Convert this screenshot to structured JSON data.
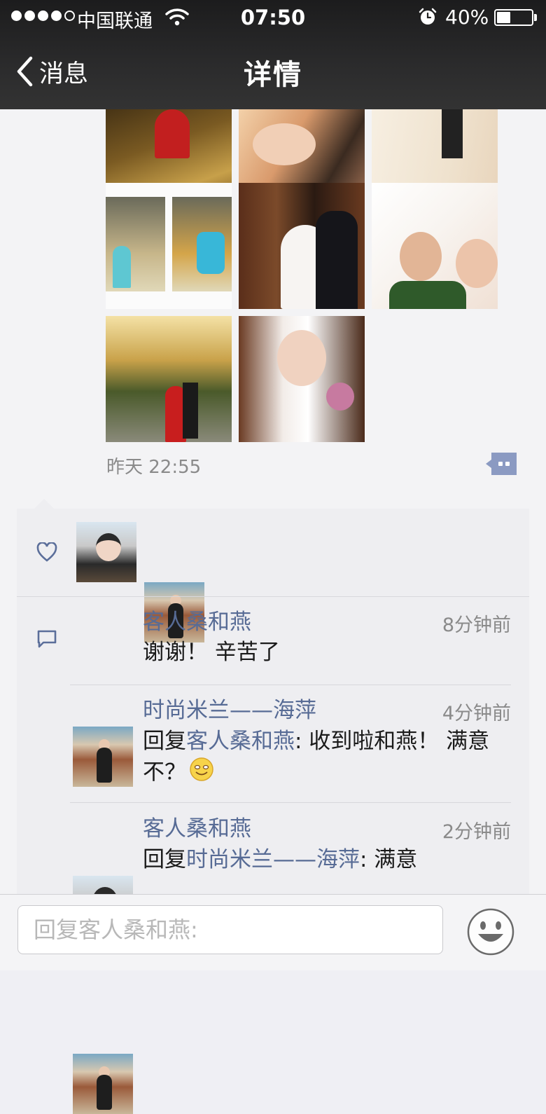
{
  "status_bar": {
    "carrier": "中国联通",
    "time": "07:50",
    "battery_percent_text": "40%",
    "battery_level": 0.4,
    "signal_bars": 4
  },
  "nav": {
    "back_label": "消息",
    "title": "详情"
  },
  "post": {
    "time": "昨天 22:55"
  },
  "comments": [
    {
      "author": "客人桑和燕",
      "time": "8分钟前",
      "text": "谢谢！ 辛苦了"
    },
    {
      "author": "时尚米兰——海萍",
      "time": "4分钟前",
      "reply_prefix": "回复",
      "reply_to": "客人桑和燕",
      "text": ": 收到啦和燕！ 满意不？"
    },
    {
      "author": "客人桑和燕",
      "time": "2分钟前",
      "reply_prefix": "回复",
      "reply_to": "时尚米兰——海萍",
      "text": ": 满意"
    }
  ],
  "reply_input": {
    "placeholder": "回复客人桑和燕:"
  },
  "colors": {
    "link": "#576b95",
    "nav_bg": "#2a2a2b",
    "panel_bg": "#eeeef1"
  }
}
